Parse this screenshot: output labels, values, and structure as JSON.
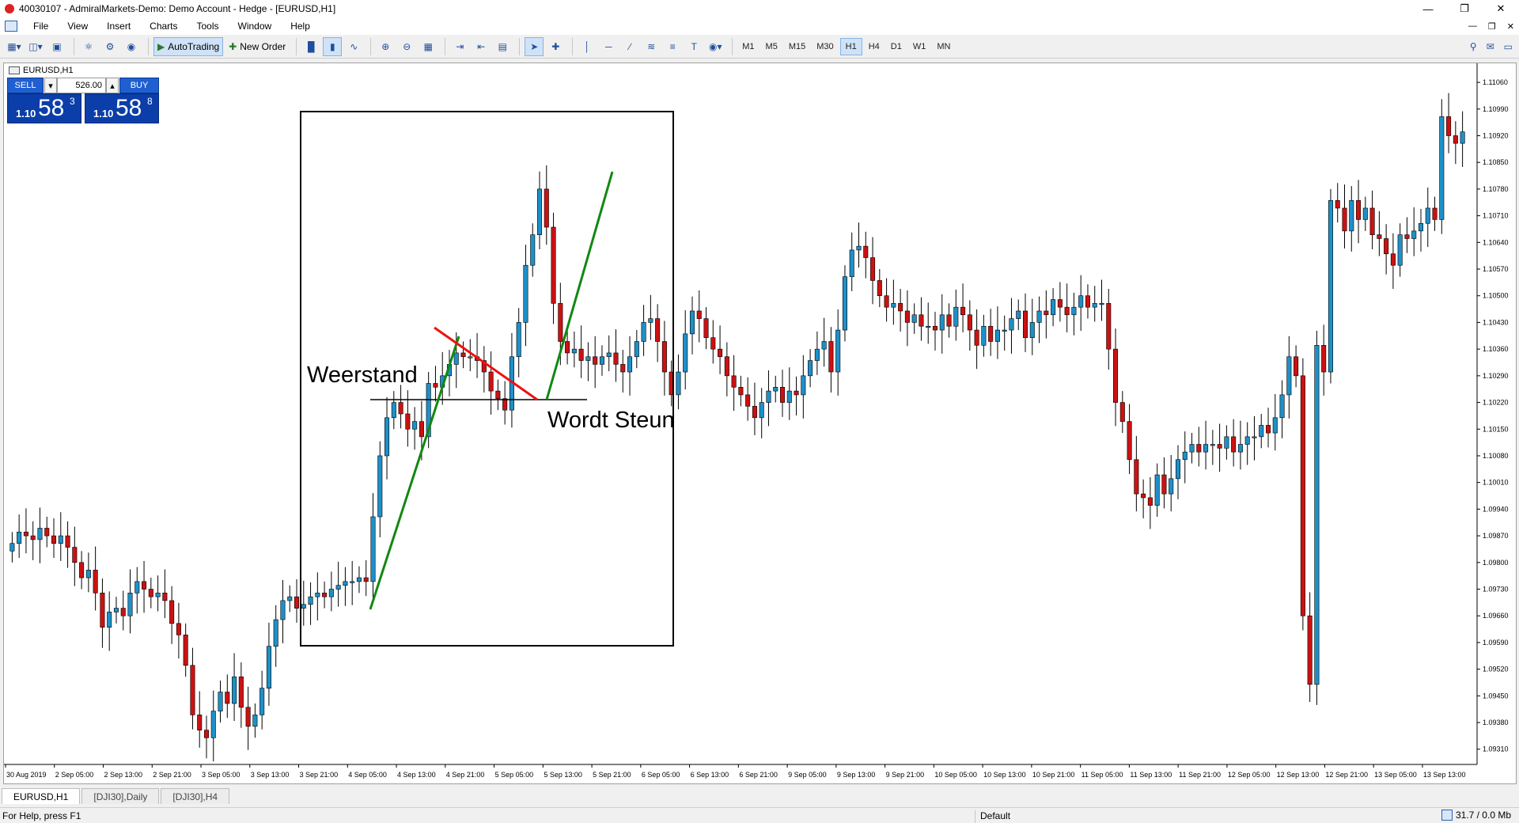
{
  "window": {
    "title": "40030107 - AdmiralMarkets-Demo: Demo Account - Hedge - [EURUSD,H1]"
  },
  "menu": [
    "File",
    "View",
    "Insert",
    "Charts",
    "Tools",
    "Window",
    "Help"
  ],
  "toolbar": {
    "autotrading_label": "AutoTrading",
    "new_order_label": "New Order",
    "timeframes": [
      "M1",
      "M5",
      "M15",
      "M30",
      "H1",
      "H4",
      "D1",
      "W1",
      "MN"
    ],
    "active_timeframe": "H1"
  },
  "chart": {
    "symbol_label": "EURUSD,H1",
    "trade_panel": {
      "sell_label": "SELL",
      "buy_label": "BUY",
      "lot_value": "526.00",
      "sell_price_small": "1.10",
      "sell_price_big": "58",
      "sell_price_sup": "3",
      "buy_price_small": "1.10",
      "buy_price_big": "58",
      "buy_price_sup": "8"
    },
    "annotations": {
      "resistance_text": "Weerstand",
      "support_text": "Wordt Steun"
    }
  },
  "colors": {
    "bull": "#1e90c8",
    "bear": "#cc1111",
    "trend_up": "#118811",
    "trend_down": "#ee1111"
  },
  "chart_data": {
    "type": "candlestick",
    "symbol": "EURUSD",
    "timeframe": "H1",
    "ylim": [
      1.0927,
      1.1111
    ],
    "y_ticks": [
      "1.11060",
      "1.10990",
      "1.10920",
      "1.10850",
      "1.10780",
      "1.10710",
      "1.10640",
      "1.10570",
      "1.10500",
      "1.10430",
      "1.10360",
      "1.10290",
      "1.10220",
      "1.10150",
      "1.10080",
      "1.10010",
      "1.09940",
      "1.09870",
      "1.09800",
      "1.09730",
      "1.09660",
      "1.09590",
      "1.09520",
      "1.09450",
      "1.09380",
      "1.09310"
    ],
    "x_ticks": [
      "30 Aug 2019",
      "2 Sep 05:00",
      "2 Sep 13:00",
      "2 Sep 21:00",
      "3 Sep 05:00",
      "3 Sep 13:00",
      "3 Sep 21:00",
      "4 Sep 05:00",
      "4 Sep 13:00",
      "4 Sep 21:00",
      "5 Sep 05:00",
      "5 Sep 13:00",
      "5 Sep 21:00",
      "6 Sep 05:00",
      "6 Sep 13:00",
      "6 Sep 21:00",
      "9 Sep 05:00",
      "9 Sep 13:00",
      "9 Sep 21:00",
      "10 Sep 05:00",
      "10 Sep 13:00",
      "10 Sep 21:00",
      "11 Sep 05:00",
      "11 Sep 13:00",
      "11 Sep 21:00",
      "12 Sep 05:00",
      "12 Sep 13:00",
      "12 Sep 21:00",
      "13 Sep 05:00",
      "13 Sep 13:00"
    ],
    "closes": [
      1.0985,
      1.0988,
      1.0987,
      1.0986,
      1.0989,
      1.0987,
      1.0985,
      1.0987,
      1.0984,
      1.098,
      1.0976,
      1.0978,
      1.0972,
      1.0963,
      1.0967,
      1.0968,
      1.0966,
      1.0972,
      1.0975,
      1.0973,
      1.0971,
      1.0972,
      1.097,
      1.0964,
      1.0961,
      1.0953,
      1.094,
      1.0936,
      1.0934,
      1.0941,
      1.0946,
      1.0943,
      1.095,
      1.0942,
      1.0937,
      1.094,
      1.0947,
      1.0958,
      1.0965,
      1.097,
      1.0971,
      1.0968,
      1.0969,
      1.0971,
      1.0972,
      1.0971,
      1.0973,
      1.0974,
      1.0975,
      1.0975,
      1.0976,
      1.0975,
      1.0992,
      1.1008,
      1.1018,
      1.1022,
      1.1019,
      1.1015,
      1.1017,
      1.1013,
      1.1027,
      1.1026,
      1.1029,
      1.1032,
      1.1035,
      1.1034,
      1.1034,
      1.1033,
      1.103,
      1.1025,
      1.1023,
      1.102,
      1.1034,
      1.1043,
      1.1058,
      1.1066,
      1.1078,
      1.1068,
      1.1048,
      1.1038,
      1.1035,
      1.1036,
      1.1033,
      1.1034,
      1.1032,
      1.1034,
      1.1035,
      1.1032,
      1.103,
      1.1034,
      1.1038,
      1.1043,
      1.1044,
      1.1038,
      1.103,
      1.1024,
      1.103,
      1.104,
      1.1046,
      1.1044,
      1.1039,
      1.1036,
      1.1034,
      1.1029,
      1.1026,
      1.1024,
      1.1021,
      1.1018,
      1.1022,
      1.1025,
      1.1026,
      1.1022,
      1.1025,
      1.1024,
      1.1029,
      1.1033,
      1.1036,
      1.1038,
      1.103,
      1.1041,
      1.1055,
      1.1062,
      1.1063,
      1.106,
      1.1054,
      1.105,
      1.1047,
      1.1048,
      1.1046,
      1.1043,
      1.1045,
      1.1042,
      1.1042,
      1.1041,
      1.1045,
      1.1042,
      1.1047,
      1.1045,
      1.1041,
      1.1037,
      1.1042,
      1.1038,
      1.1041,
      1.1041,
      1.1044,
      1.1046,
      1.1039,
      1.1043,
      1.1046,
      1.1045,
      1.1049,
      1.1047,
      1.1045,
      1.1047,
      1.105,
      1.1047,
      1.1048,
      1.1048,
      1.1036,
      1.1022,
      1.1017,
      1.1007,
      1.0998,
      1.0997,
      1.0995,
      1.1003,
      1.0998,
      1.1002,
      1.1007,
      1.1009,
      1.1011,
      1.1009,
      1.1011,
      1.1011,
      1.101,
      1.1013,
      1.1009,
      1.1011,
      1.1013,
      1.1013,
      1.1016,
      1.1014,
      1.1018,
      1.1024,
      1.1034,
      1.1029,
      1.0966,
      1.0948,
      1.1037,
      1.103,
      1.1075,
      1.1073,
      1.1067,
      1.1075,
      1.107,
      1.1073,
      1.1066,
      1.1065,
      1.1061,
      1.1058,
      1.1066,
      1.1065,
      1.1067,
      1.1069,
      1.1073,
      1.107,
      1.1097,
      1.1092,
      1.109,
      1.1093
    ],
    "annotations": [
      "Weerstand",
      "Wordt Steun"
    ]
  },
  "tabs": [
    "EURUSD,H1",
    "[DJI30],Daily",
    "[DJI30],H4"
  ],
  "active_tab": "EURUSD,H1",
  "status": {
    "help_text": "For Help, press F1",
    "profile": "Default",
    "traffic": "31.7 / 0.0 Mb"
  }
}
